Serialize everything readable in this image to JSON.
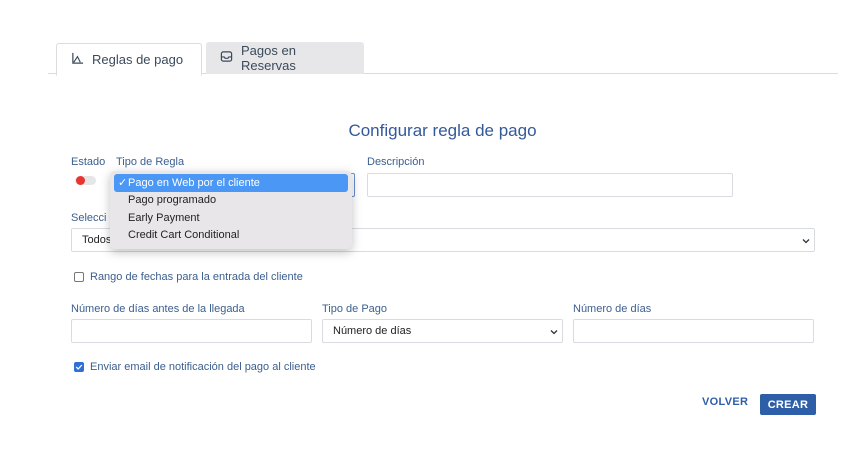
{
  "tabs": [
    {
      "label": "Reglas de pago",
      "icon": "chart-icon",
      "active": true
    },
    {
      "label": "Pagos en Reservas",
      "icon": "inbox-icon",
      "active": false
    }
  ],
  "page_title": "Configurar regla de pago",
  "form": {
    "estado_label": "Estado",
    "tipo_regla_label": "Tipo de Regla",
    "descripcion_label": "Descripción",
    "descripcion_value": "",
    "seleccion_label": "Selecci",
    "seleccion_value": "Todos",
    "tipo_regla_options": [
      "Pago en Web por el cliente",
      "Pago programado",
      "Early Payment",
      "Credit Cart Conditional"
    ],
    "tipo_regla_selected_check": "✓",
    "rango_fechas_label": "Rango de fechas para la entrada del cliente",
    "rango_fechas_checked": false,
    "dias_antes_label": "Número de días antes de la llegada",
    "dias_antes_value": "",
    "tipo_pago_label": "Tipo de Pago",
    "tipo_pago_value": "Número de días",
    "numero_dias_label": "Número de días",
    "numero_dias_value": "",
    "email_label": "Enviar email de notificación del pago al cliente",
    "email_checked": true
  },
  "buttons": {
    "back_label": "VOLVER",
    "create_label": "CREAR"
  },
  "colors": {
    "accent": "#2f5ea8",
    "toggle_off": "#e8352f",
    "selected_option": "#4a97f5"
  }
}
